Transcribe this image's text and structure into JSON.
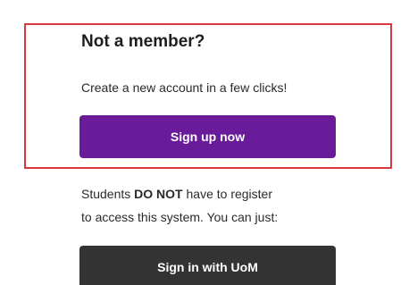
{
  "signup_section": {
    "title": "Not a member?",
    "description": "Create a new account in a few clicks!",
    "button_label": "Sign up now",
    "highlight_color": "#d9383e"
  },
  "students_info": {
    "line1_prefix": "Students ",
    "line1_emphasis_1": "DO",
    "line1_emphasis_2": "NOT",
    "line1_suffix": " have to register",
    "line2": "to access this system. You can just:"
  },
  "uom_signin": {
    "button_label": "Sign in with UoM"
  },
  "colors": {
    "signup_button": "#6a1b9a",
    "uom_button": "#333333"
  }
}
